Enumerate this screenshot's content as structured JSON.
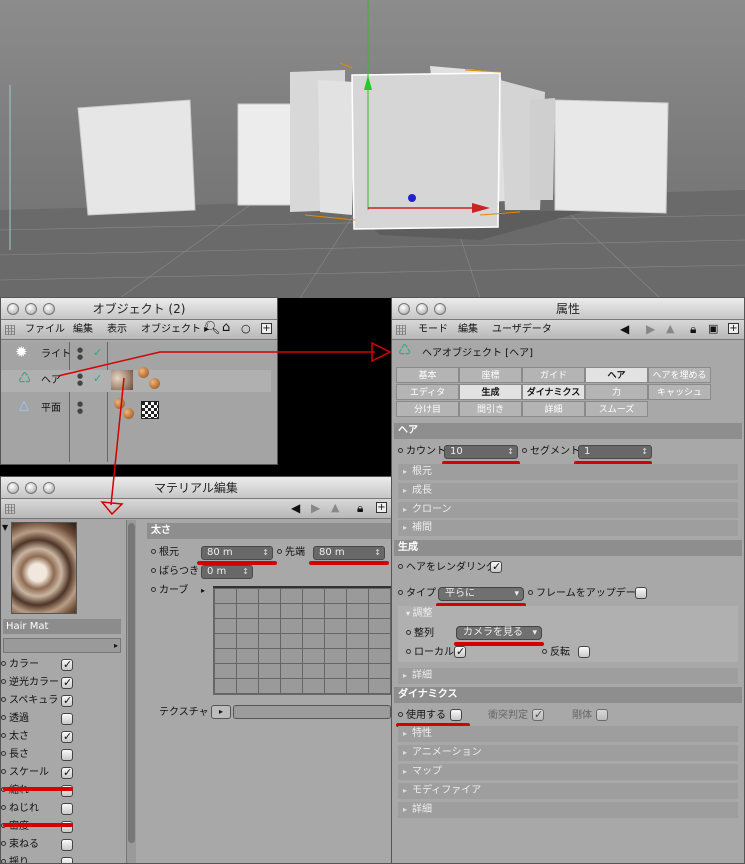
{
  "object_manager": {
    "title": "オブジェクト (2)",
    "menu": [
      "ファイル",
      "編集",
      "表示",
      "オブジェクト ▸"
    ],
    "objects": [
      {
        "name": "ライト"
      },
      {
        "name": "ヘア"
      },
      {
        "name": "平面"
      }
    ]
  },
  "attributes": {
    "title": "属性",
    "menu": [
      "モード",
      "編集",
      "ユーザデータ"
    ],
    "object_label": "ヘアオブジェクト [ヘア]",
    "tabs_row1": [
      "基本",
      "座標",
      "ガイド",
      "ヘア",
      "ヘアを埋める"
    ],
    "tabs_row2": [
      "エディタ",
      "生成",
      "ダイナミクス",
      "力",
      "キャッシュ"
    ],
    "tabs_row3": [
      "分け目",
      "間引き",
      "詳細",
      "スムーズ"
    ],
    "hair_section": {
      "title": "ヘア",
      "count_label": "カウント",
      "count_value": "10",
      "segment_label": "セグメント",
      "segment_value": "1",
      "subgroups": [
        "根元",
        "成長",
        "クローン",
        "補間"
      ]
    },
    "generate_section": {
      "title": "生成",
      "render_label": "ヘアをレンダリング",
      "type_label": "タイプ",
      "type_value": "平らに",
      "frame_update_label": "フレームをアップデート",
      "adjust_label": "調整",
      "align_label": "整列",
      "align_value": "カメラを見る",
      "local_label": "ローカル",
      "flip_label": "反転",
      "detail_label": "詳細"
    },
    "dynamics_section": {
      "title": "ダイナミクス",
      "use_label": "使用する",
      "collision_label": "衝突判定",
      "rigid_label": "剛体",
      "subgroups": [
        "特性",
        "アニメーション",
        "マップ",
        "モディファイア",
        "詳細"
      ]
    }
  },
  "material_editor": {
    "title": "マテリアル編集",
    "material_name": "Hair Mat",
    "channels": [
      {
        "label": "カラー",
        "on": true
      },
      {
        "label": "逆光カラー",
        "on": true
      },
      {
        "label": "スペキュラ",
        "on": true
      },
      {
        "label": "透過",
        "on": false
      },
      {
        "label": "太さ",
        "on": true
      },
      {
        "label": "長さ",
        "on": false
      },
      {
        "label": "スケール",
        "on": true
      },
      {
        "label": "縮れ",
        "on": false
      },
      {
        "label": "ねじれ",
        "on": false
      },
      {
        "label": "密度",
        "on": false
      },
      {
        "label": "束ねる",
        "on": false
      },
      {
        "label": "揺り",
        "on": false
      }
    ],
    "thickness": {
      "title": "太さ",
      "root_label": "根元",
      "root_value": "80 m",
      "tip_label": "先端",
      "tip_value": "80 m",
      "variation_label": "ばらつき",
      "variation_value": "0 m",
      "curve_label": "カーブ",
      "texture_label": "テクスチャ"
    }
  },
  "colors": {
    "panel_bg": "#a8a8a8",
    "annotation_red": "#d40000",
    "hair_icon": "#3aa882"
  }
}
